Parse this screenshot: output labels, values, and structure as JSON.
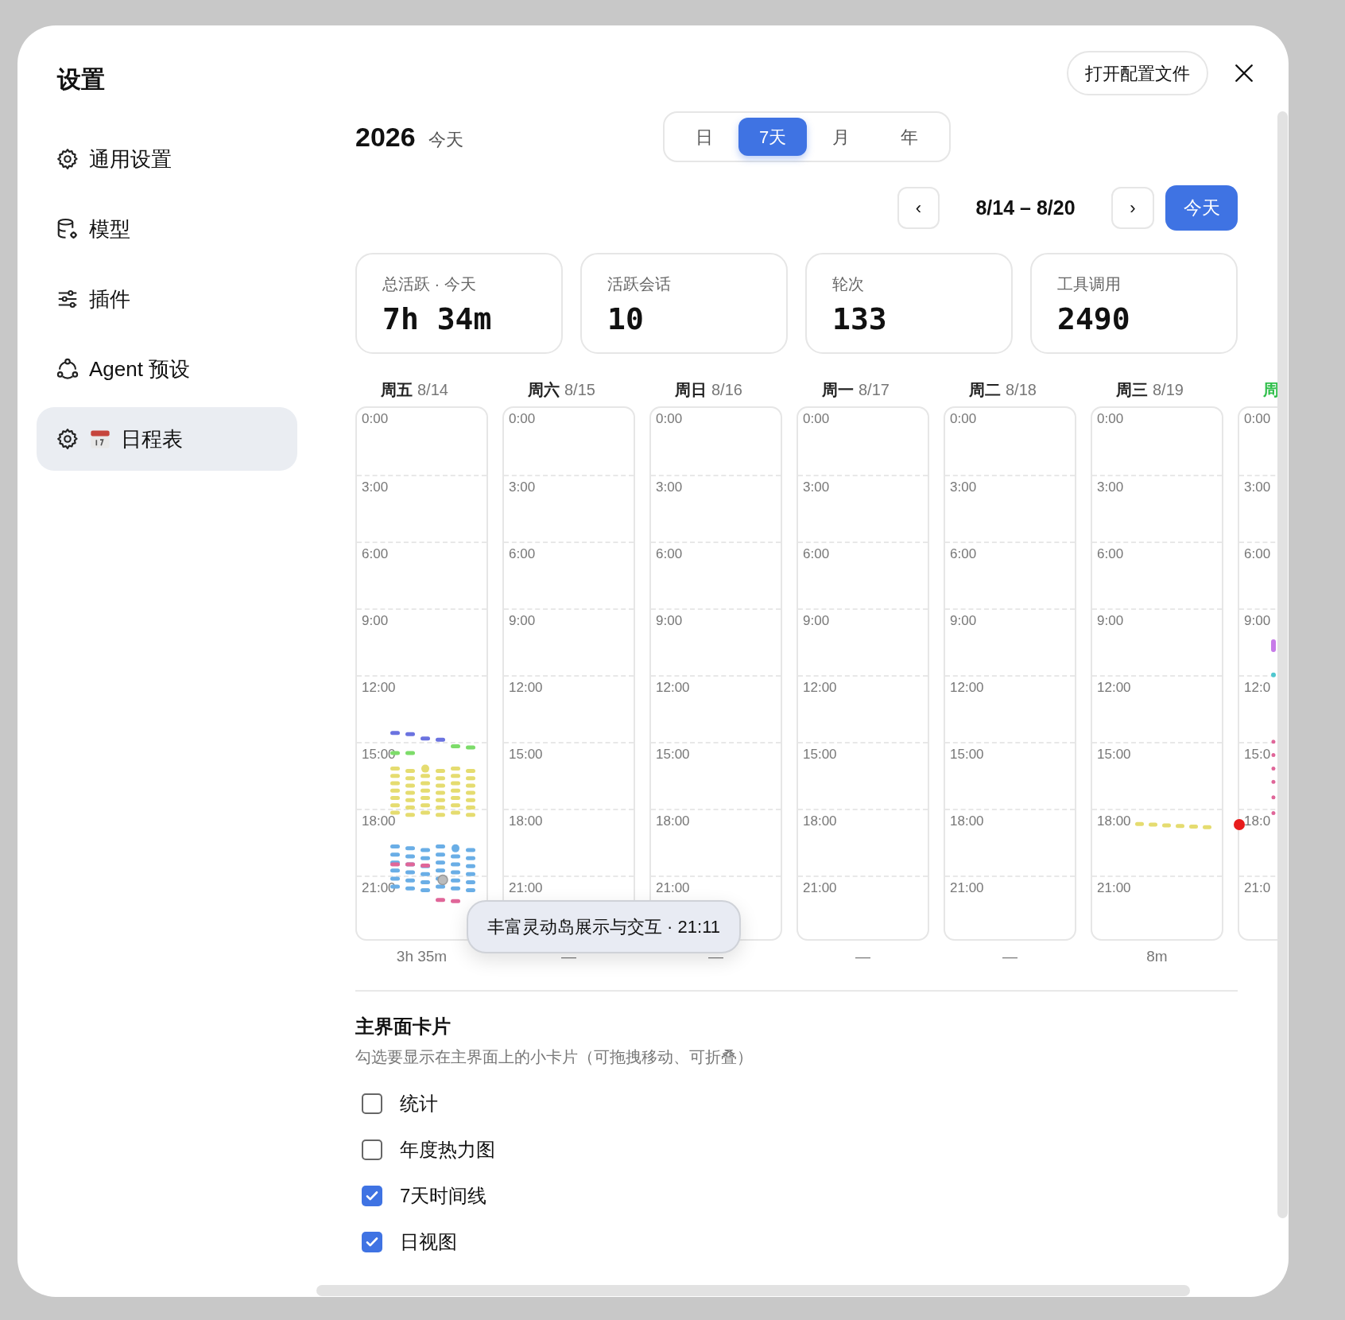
{
  "window": {
    "title": "设置",
    "open_config_button": "打开配置文件"
  },
  "sidebar": {
    "items": [
      {
        "label": "通用设置",
        "selected": false
      },
      {
        "label": "模型",
        "selected": false
      },
      {
        "label": "插件",
        "selected": false
      },
      {
        "label": "Agent 预设",
        "selected": false
      },
      {
        "label": "日程表",
        "selected": true
      }
    ]
  },
  "header": {
    "year": "2026",
    "today_label": "今天"
  },
  "range_tabs": [
    {
      "label": "日",
      "selected": false
    },
    {
      "label": "7天",
      "selected": true
    },
    {
      "label": "月",
      "selected": false
    },
    {
      "label": "年",
      "selected": false
    }
  ],
  "nav": {
    "prev": "‹",
    "range": "8/14 – 8/20",
    "next": "›",
    "today": "今天"
  },
  "stats": [
    {
      "label": "总活跃 · 今天",
      "value": "7h 34m"
    },
    {
      "label": "活跃会话",
      "value": "10"
    },
    {
      "label": "轮次",
      "value": "133"
    },
    {
      "label": "工具调用",
      "value": "2490"
    }
  ],
  "timeline": {
    "days": [
      {
        "weekday": "周五",
        "date": "8/14",
        "today": false,
        "kind": "busy",
        "hours": [
          "0:00",
          "3:00",
          "6:00",
          "9:00",
          "12:00",
          "15:00",
          "18:00",
          "21:00"
        ],
        "total": "3h 35m"
      },
      {
        "weekday": "周六",
        "date": "8/15",
        "today": false,
        "kind": "empty",
        "hours": [
          "0:00",
          "3:00",
          "6:00",
          "9:00",
          "12:00",
          "15:00",
          "18:00",
          "21:00"
        ],
        "total": "—"
      },
      {
        "weekday": "周日",
        "date": "8/16",
        "today": false,
        "kind": "empty",
        "hours": [
          "0:00",
          "3:00",
          "6:00",
          "9:00",
          "12:00",
          "15:00",
          "18:00",
          "21:00"
        ],
        "total": "—"
      },
      {
        "weekday": "周一",
        "date": "8/17",
        "today": false,
        "kind": "empty",
        "hours": [
          "0:00",
          "3:00",
          "6:00",
          "9:00",
          "12:00",
          "15:00",
          "18:00",
          "21:00"
        ],
        "total": "—"
      },
      {
        "weekday": "周二",
        "date": "8/18",
        "today": false,
        "kind": "empty",
        "hours": [
          "0:00",
          "3:00",
          "6:00",
          "9:00",
          "12:00",
          "15:00",
          "18:00",
          "21:00"
        ],
        "total": "—"
      },
      {
        "weekday": "周三",
        "date": "8/19",
        "today": false,
        "kind": "trail",
        "hours": [
          "0:00",
          "3:00",
          "6:00",
          "9:00",
          "12:00",
          "15:00",
          "18:00",
          "21:00"
        ],
        "total": "8m"
      },
      {
        "weekday": "周",
        "today": true,
        "kind": "now",
        "hours": [
          "0:00",
          "3:00",
          "6:00",
          "9:00",
          "12:0",
          "15:0",
          "18:0",
          "21:0"
        ]
      }
    ],
    "tooltip": "丰富灵动岛展示与交互 · 21:11"
  },
  "cards": {
    "title": "主界面卡片",
    "description": "勾选要显示在主界面上的小卡片（可拖拽移动、可折叠）",
    "options": [
      {
        "label": "统计",
        "checked": false
      },
      {
        "label": "年度热力图",
        "checked": false
      },
      {
        "label": "7天时间线",
        "checked": true
      },
      {
        "label": "日视图",
        "checked": true
      }
    ]
  }
}
